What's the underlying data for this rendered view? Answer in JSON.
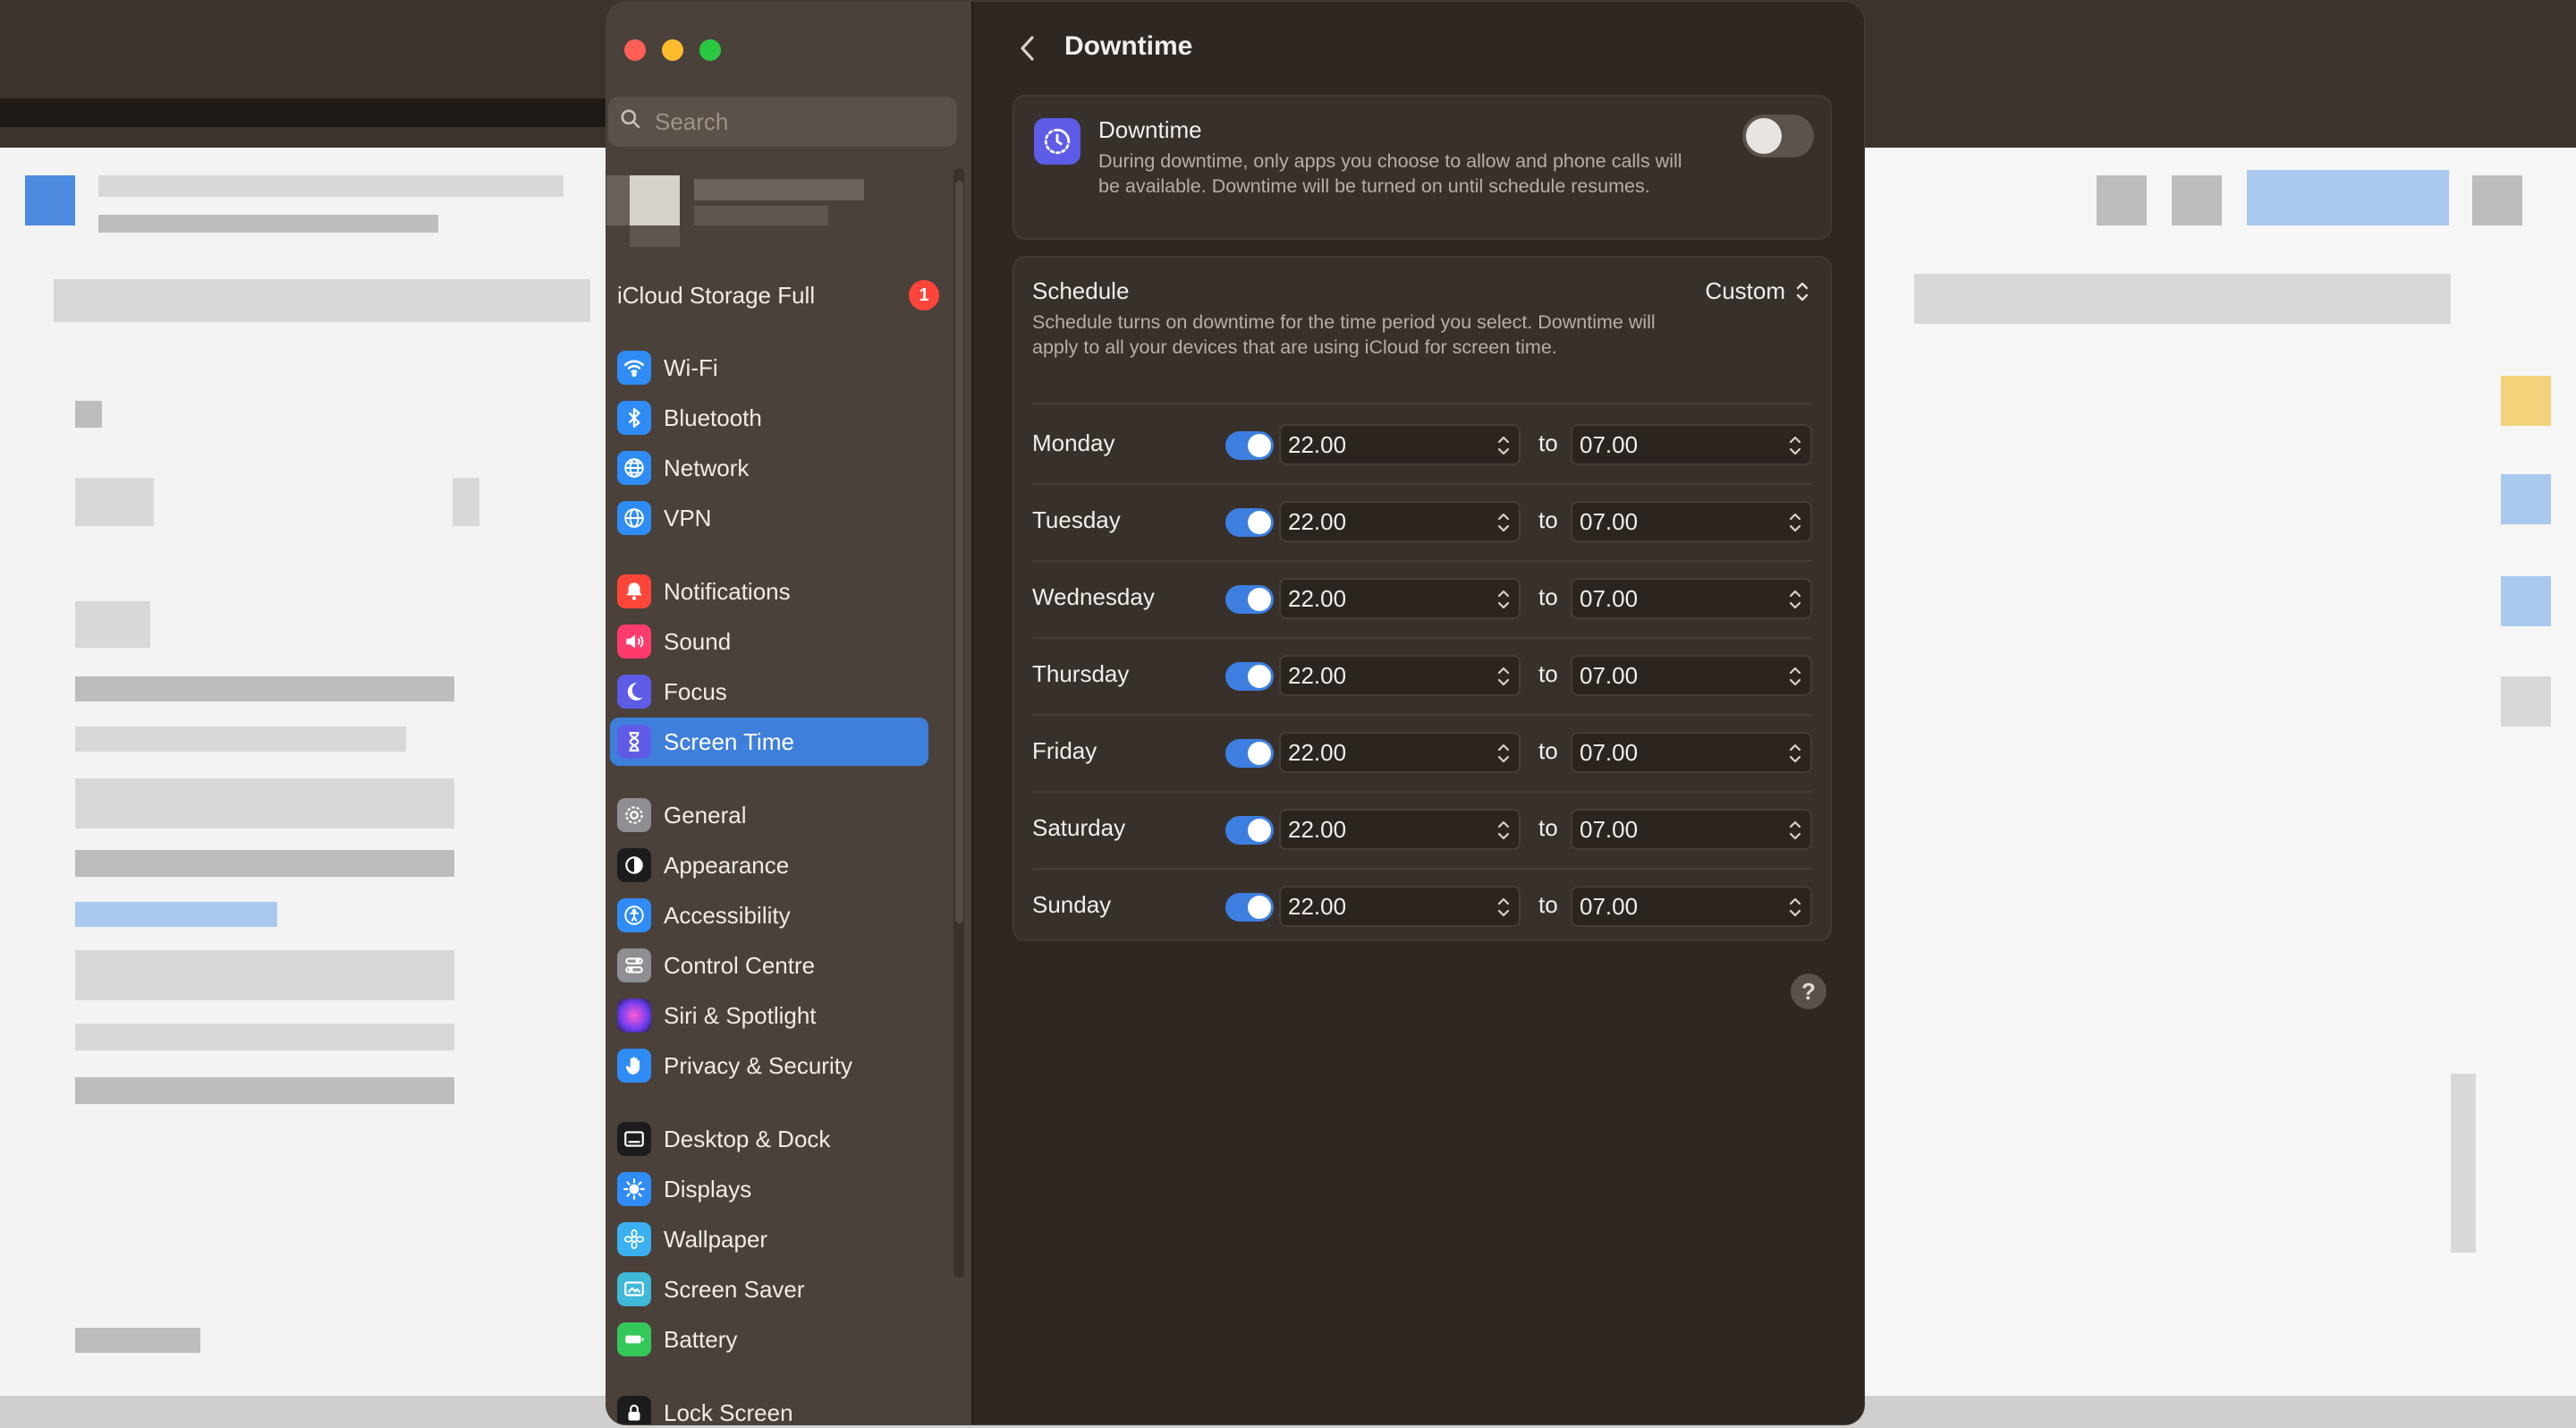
{
  "window": {
    "title": "Downtime"
  },
  "search": {
    "placeholder": "Search"
  },
  "icloud": {
    "label": "iCloud Storage Full",
    "badge": "1"
  },
  "sidebar": {
    "items": [
      {
        "label": "Wi-Fi",
        "icon": "wifi-icon",
        "color": "#2f8cf4"
      },
      {
        "label": "Bluetooth",
        "icon": "bluetooth-icon",
        "color": "#2f8cf4"
      },
      {
        "label": "Network",
        "icon": "globe-icon",
        "color": "#2f8cf4"
      },
      {
        "label": "VPN",
        "icon": "vpn-globe-icon",
        "color": "#2f8cf4"
      },
      {
        "label": "Notifications",
        "icon": "bell-icon",
        "color": "#ff453a"
      },
      {
        "label": "Sound",
        "icon": "speaker-icon",
        "color": "#ff3b6b"
      },
      {
        "label": "Focus",
        "icon": "moon-icon",
        "color": "#5e5ce6"
      },
      {
        "label": "Screen Time",
        "icon": "hourglass-icon",
        "color": "#5e5ce6"
      },
      {
        "label": "General",
        "icon": "gear-icon",
        "color": "#8e8e93"
      },
      {
        "label": "Appearance",
        "icon": "appearance-icon",
        "color": "#1c1c1e"
      },
      {
        "label": "Accessibility",
        "icon": "accessibility-icon",
        "color": "#2f8cf4"
      },
      {
        "label": "Control Centre",
        "icon": "control-centre-icon",
        "color": "#8e8e93"
      },
      {
        "label": "Siri & Spotlight",
        "icon": "siri-icon",
        "color": "#b03bd6"
      },
      {
        "label": "Privacy & Security",
        "icon": "hand-icon",
        "color": "#2f8cf4"
      },
      {
        "label": "Desktop & Dock",
        "icon": "dock-icon",
        "color": "#1c1c1e"
      },
      {
        "label": "Displays",
        "icon": "sun-icon",
        "color": "#2f8cf4"
      },
      {
        "label": "Wallpaper",
        "icon": "flower-icon",
        "color": "#3ab0f0"
      },
      {
        "label": "Screen Saver",
        "icon": "screen-saver-icon",
        "color": "#40b8d8"
      },
      {
        "label": "Battery",
        "icon": "battery-icon",
        "color": "#34c759"
      },
      {
        "label": "Lock Screen",
        "icon": "lock-icon",
        "color": "#1c1c1e"
      }
    ],
    "active": "Screen Time"
  },
  "downtime": {
    "title": "Downtime",
    "description": "During downtime, only apps you choose to allow and phone calls will be available. Downtime will be turned on until schedule resumes.",
    "enabled": false
  },
  "schedule": {
    "title": "Schedule",
    "description": "Schedule turns on downtime for the time period you select. Downtime will apply to all your devices that are using iCloud for screen time.",
    "mode": "Custom",
    "to_label": "to",
    "days": [
      {
        "name": "Monday",
        "enabled": true,
        "start": "22.00",
        "end": "07.00"
      },
      {
        "name": "Tuesday",
        "enabled": true,
        "start": "22.00",
        "end": "07.00"
      },
      {
        "name": "Wednesday",
        "enabled": true,
        "start": "22.00",
        "end": "07.00"
      },
      {
        "name": "Thursday",
        "enabled": true,
        "start": "22.00",
        "end": "07.00"
      },
      {
        "name": "Friday",
        "enabled": true,
        "start": "22.00",
        "end": "07.00"
      },
      {
        "name": "Saturday",
        "enabled": true,
        "start": "22.00",
        "end": "07.00"
      },
      {
        "name": "Sunday",
        "enabled": true,
        "start": "22.00",
        "end": "07.00"
      }
    ]
  },
  "help": {
    "label": "?"
  },
  "colors": {
    "accent": "#3f7fdc",
    "toggle_on": "#3d7fe0",
    "badge": "#ff453a"
  }
}
